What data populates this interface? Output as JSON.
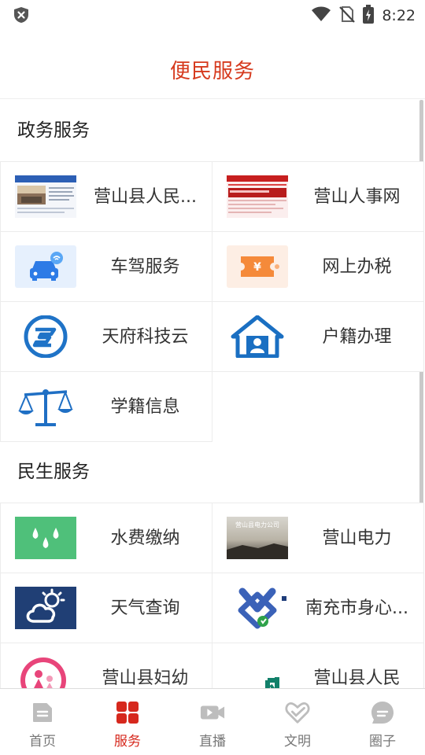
{
  "status_bar": {
    "time": "8:22"
  },
  "header": {
    "title": "便民服务"
  },
  "sections": [
    {
      "title": "政务服务",
      "items": [
        {
          "label": "营山县人民...",
          "icon": "gov-website-thumbnail"
        },
        {
          "label": "营山人事网",
          "icon": "hr-website-thumbnail"
        },
        {
          "label": "车驾服务",
          "icon": "car-icon"
        },
        {
          "label": "网上办税",
          "icon": "tax-ticket-icon"
        },
        {
          "label": "天府科技云",
          "icon": "tech-cloud-logo"
        },
        {
          "label": "户籍办理",
          "icon": "house-person-icon"
        },
        {
          "label": "学籍信息",
          "icon": "scales-icon"
        }
      ]
    },
    {
      "title": "民生服务",
      "items": [
        {
          "label": "水费缴纳",
          "icon": "water-drops-icon"
        },
        {
          "label": "营山电力",
          "icon": "power-company-thumbnail",
          "thumb_text": "营山县电力公司"
        },
        {
          "label": "天气查询",
          "icon": "weather-icon"
        },
        {
          "label": "南充市身心...",
          "icon": "health-logo"
        },
        {
          "label": "营山县妇幼",
          "icon": "maternal-child-logo"
        },
        {
          "label": "营山县人民",
          "icon": "hospital-logo"
        }
      ]
    }
  ],
  "bottom_nav": [
    {
      "label": "首页",
      "icon": "home-icon",
      "active": false
    },
    {
      "label": "服务",
      "icon": "grid-icon",
      "active": true
    },
    {
      "label": "直播",
      "icon": "video-camera-icon",
      "active": false
    },
    {
      "label": "文明",
      "icon": "heart-hands-icon",
      "active": false
    },
    {
      "label": "圈子",
      "icon": "chat-circle-icon",
      "active": false
    }
  ],
  "colors": {
    "accent": "#d6281d",
    "title": "#d63a1e"
  }
}
